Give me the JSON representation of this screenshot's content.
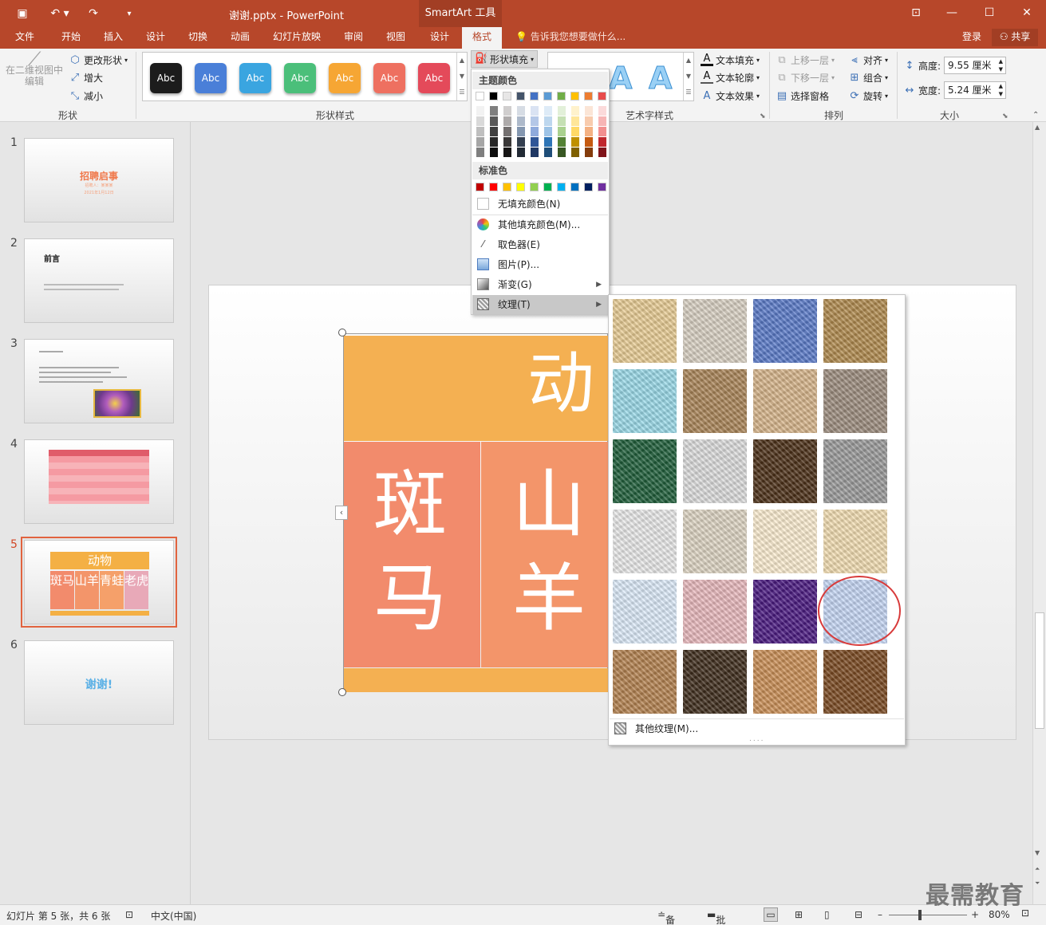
{
  "window": {
    "title": "谢谢.pptx - PowerPoint",
    "contextual_tab_group": "SmartArt 工具",
    "controls": [
      "⊡",
      "—",
      "☐",
      "✕"
    ]
  },
  "tabs": [
    "文件",
    "开始",
    "插入",
    "设计",
    "切换",
    "动画",
    "幻灯片放映",
    "审阅",
    "视图",
    "设计",
    "格式"
  ],
  "tell_me": "告诉我您想要做什么...",
  "account": {
    "login": "登录",
    "share": "共享"
  },
  "ribbon": {
    "shapes_group": {
      "label": "形状",
      "edit_in_2d": "在二维视图中编辑",
      "change_shape": "更改形状",
      "larger": "增大",
      "smaller": "减小"
    },
    "shape_styles": {
      "label": "形状样式",
      "styles": [
        {
          "text": "Abc",
          "color": "#1c1c1c"
        },
        {
          "text": "Abc",
          "color": "#4a7fd8"
        },
        {
          "text": "Abc",
          "color": "#3aa5e0"
        },
        {
          "text": "Abc",
          "color": "#4bbf7a"
        },
        {
          "text": "Abc",
          "color": "#f6a634"
        },
        {
          "text": "Abc",
          "color": "#ee7060"
        },
        {
          "text": "Abc",
          "color": "#e44a5a"
        }
      ],
      "fill_button": "形状填充"
    },
    "wordart": {
      "label": "艺术字样式",
      "text_fill": "文本填充",
      "text_outline": "文本轮廓",
      "text_effects": "文本效果"
    },
    "arrange": {
      "label": "排列",
      "bring_forward": "上移一层",
      "send_backward": "下移一层",
      "selection_pane": "选择窗格",
      "align": "对齐",
      "group": "组合",
      "rotate": "旋转"
    },
    "size": {
      "label": "大小",
      "height_label": "高度:",
      "height_value": "9.55 厘米",
      "width_label": "宽度:",
      "width_value": "5.24 厘米"
    }
  },
  "fill_menu": {
    "theme_colors_header": "主题颜色",
    "theme_top_row": [
      "#ffffff",
      "#000000",
      "#e7e6e6",
      "#44546a",
      "#4472c4",
      "#5b9bd5",
      "#70ad47",
      "#ffc000",
      "#ed7d31",
      "#e84c4c"
    ],
    "theme_shades": [
      [
        "#f2f2f2",
        "#7f7f7f",
        "#d0cece",
        "#d6dce4",
        "#dae3f3",
        "#deebf7",
        "#e2f0d9",
        "#fff2cc",
        "#fbe5d6",
        "#fbdada"
      ],
      [
        "#d9d9d9",
        "#595959",
        "#aeabab",
        "#adb9ca",
        "#b4c7e7",
        "#bdd7ee",
        "#c5e0b4",
        "#ffe699",
        "#f8cbad",
        "#f7b5b5"
      ],
      [
        "#bfbfbf",
        "#3f3f3f",
        "#757171",
        "#8497b0",
        "#8faadc",
        "#9dc3e6",
        "#a9d18e",
        "#ffd966",
        "#f4b183",
        "#f28f8f"
      ],
      [
        "#a6a6a6",
        "#262626",
        "#3a3838",
        "#333f50",
        "#2f5597",
        "#2e75b6",
        "#548235",
        "#bf9000",
        "#c55a11",
        "#c0272d"
      ],
      [
        "#7f7f7f",
        "#0d0d0d",
        "#171616",
        "#222a35",
        "#203864",
        "#1f4e79",
        "#385723",
        "#7f6000",
        "#843c0c",
        "#80141a"
      ]
    ],
    "standard_colors_header": "标准色",
    "standard_colors": [
      "#c00000",
      "#ff0000",
      "#ffc000",
      "#ffff00",
      "#92d050",
      "#00b050",
      "#00b0f0",
      "#0070c0",
      "#002060",
      "#7030a0"
    ],
    "no_fill": "无填充颜色(N)",
    "more_colors": "其他填充颜色(M)...",
    "eyedropper": "取色器(E)",
    "picture": "图片(P)...",
    "gradient": "渐变(G)",
    "texture": "纹理(T)"
  },
  "texture_panel": {
    "textures": [
      [
        "papyrus",
        "canvas",
        "denim",
        "woven-mat"
      ],
      [
        "water-droplets",
        "paper-bag",
        "fish-fossil",
        "sand"
      ],
      [
        "green-marble",
        "white-marble",
        "brown-marble",
        "granite"
      ],
      [
        "newsprint",
        "recycled-paper",
        "parchment",
        "stationery"
      ],
      [
        "blue-tissue",
        "pink-tissue",
        "purple-mesh",
        "bouquet"
      ],
      [
        "cork",
        "walnut",
        "oak",
        "medium-wood"
      ]
    ],
    "texture_colors": [
      [
        "#e8cc94",
        "#d8d0c2",
        "#5a7ac8",
        "#b08a4e"
      ],
      [
        "#9ad9e8",
        "#a98458",
        "#d6b48a",
        "#9c8c7e"
      ],
      [
        "#1f5e3a",
        "#dcdcdc",
        "#4c3018",
        "#9a9a9a"
      ],
      [
        "#e9e9e9",
        "#ddd4c2",
        "#fbecd0",
        "#f2ddb2"
      ],
      [
        "#dceaf8",
        "#e8b8bc",
        "#4a1a80",
        "#c5d6f4"
      ],
      [
        "#b3814f",
        "#3e2c1c",
        "#c98e56",
        "#7a4a22"
      ]
    ],
    "selected": "bouquet",
    "more_textures": "其他纹理(M)..."
  },
  "slides": [
    {
      "number": "1",
      "title": "招聘启事",
      "subtitle": "招聘人：某某某",
      "date": "2021年1月12日"
    },
    {
      "number": "2",
      "title": "前言"
    },
    {
      "number": "3"
    },
    {
      "number": "4"
    },
    {
      "number": "5",
      "title": "动物",
      "items": [
        "斑马",
        "山羊",
        "青蛙",
        "老虎"
      ]
    },
    {
      "number": "6",
      "title": "谢谢!"
    }
  ],
  "canvas": {
    "top_text": "动",
    "cells": [
      {
        "text": "斑马"
      },
      {
        "text": "山羊"
      }
    ]
  },
  "status": {
    "slide_info": "幻灯片 第 5 张，共 6 张",
    "language": "中文(中国)",
    "notes": "备注",
    "comments": "批注",
    "zoom": "80%"
  },
  "watermark": "最需教育"
}
